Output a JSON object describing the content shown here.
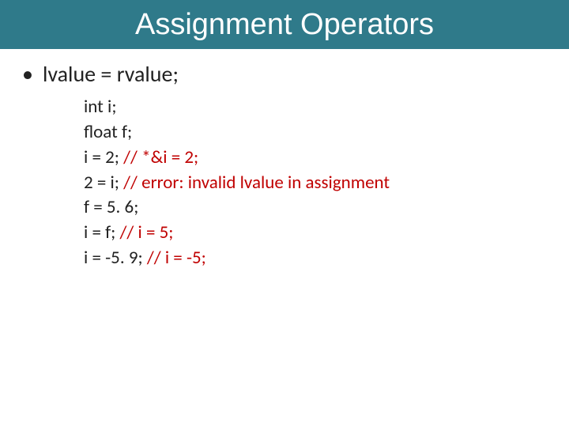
{
  "title": "Assignment Operators",
  "bullet": {
    "symbol": "•",
    "text": "lvalue = rvalue;"
  },
  "code": {
    "l1": "int  i;",
    "l2": "float f;",
    "l3a": "i = 2;  ",
    "l3b": "// *&i = 2;",
    "l4a": "2 = i; ",
    "l4b": "// error: invalid lvalue in assignment",
    "l5": "f = 5. 6;",
    "l6a": "i = f; ",
    "l6b": "// i = 5;",
    "l7a": "i = -5. 9; ",
    "l7b": "// i = -5;"
  }
}
